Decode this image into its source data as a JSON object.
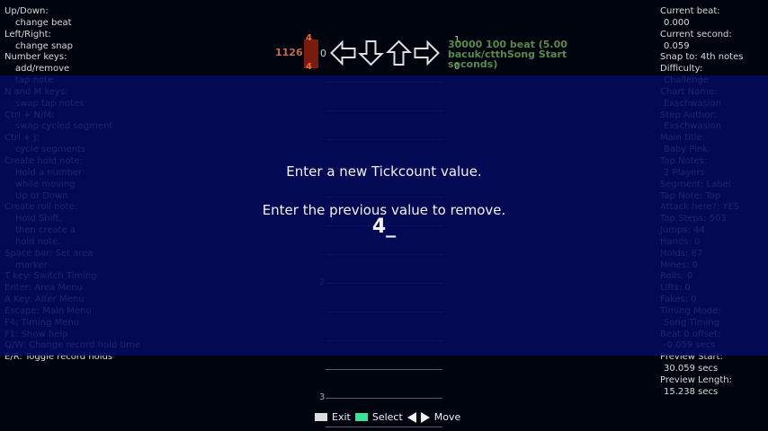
{
  "help": {
    "lines": [
      {
        "text": "Up/Down:",
        "indent": false
      },
      {
        "text": "change beat",
        "indent": true
      },
      {
        "text": "Left/Right:",
        "indent": false
      },
      {
        "text": "change snap",
        "indent": true
      },
      {
        "text": "Number keys:",
        "indent": false
      },
      {
        "text": "add/remove",
        "indent": true
      },
      {
        "text": "tap note",
        "indent": true
      },
      {
        "text": "N and M keys:",
        "indent": false
      },
      {
        "text": "swap tap notes",
        "indent": true
      },
      {
        "text": "Ctrl + N/M:",
        "indent": false
      },
      {
        "text": "swap cycled segment",
        "indent": true
      },
      {
        "text": "Ctrl + J:",
        "indent": false
      },
      {
        "text": "cycle segments",
        "indent": true
      },
      {
        "text": "Create hold note:",
        "indent": false
      },
      {
        "text": "Hold a number",
        "indent": true
      },
      {
        "text": "while moving",
        "indent": true
      },
      {
        "text": "Up or Down",
        "indent": true
      },
      {
        "text": "Create roll note:",
        "indent": false
      },
      {
        "text": "Hold Shift,",
        "indent": true
      },
      {
        "text": "then create a",
        "indent": true
      },
      {
        "text": "hold note.",
        "indent": true
      },
      {
        "text": "Space bar: Set area",
        "indent": false
      },
      {
        "text": "marker",
        "indent": true
      },
      {
        "text": "T key: Switch Timing",
        "indent": false
      },
      {
        "text": "Enter: Area Menu",
        "indent": false
      },
      {
        "text": "A Key: Alter Menu",
        "indent": false
      },
      {
        "text": "Escape: Main Menu",
        "indent": false
      },
      {
        "text": "F4: Timing Menu",
        "indent": false
      },
      {
        "text": "F1: Show help",
        "indent": false
      },
      {
        "text": "Q/W: Change record hold time",
        "indent": false
      },
      {
        "text": "E/R: Toggle record holds",
        "indent": false
      }
    ]
  },
  "info": {
    "lines": [
      {
        "text": "Current beat:",
        "indent": false
      },
      {
        "text": "0.000",
        "indent": true
      },
      {
        "text": "Current second:",
        "indent": false
      },
      {
        "text": "0.059",
        "indent": true
      },
      {
        "text": "Snap to: 4th notes",
        "indent": false
      },
      {
        "text": "Difficulty:",
        "indent": false
      },
      {
        "text": "Challenge",
        "indent": true
      },
      {
        "text": "Chart Name:",
        "indent": false
      },
      {
        "text": "Exschwasion",
        "indent": true
      },
      {
        "text": "Step Author:",
        "indent": false
      },
      {
        "text": "Exschwasion",
        "indent": true
      },
      {
        "text": "Main title:",
        "indent": false
      },
      {
        "text": "Baby Pink",
        "indent": true
      },
      {
        "text": "Tap Notes:",
        "indent": false
      },
      {
        "text": "2 Players",
        "indent": true
      },
      {
        "text": "Segment: Label",
        "indent": false
      },
      {
        "text": "Tap Note: Tap",
        "indent": false
      },
      {
        "text": "Attack here?: YES",
        "indent": false
      },
      {
        "text": "Tap Steps: 503",
        "indent": false
      },
      {
        "text": "Jumps: 44",
        "indent": false
      },
      {
        "text": "Hands: 0",
        "indent": false
      },
      {
        "text": "Holds: 87",
        "indent": false
      },
      {
        "text": "Mines: 0",
        "indent": false
      },
      {
        "text": "Rolls: 0",
        "indent": false
      },
      {
        "text": "Lifts: 0",
        "indent": false
      },
      {
        "text": "Fakes: 0",
        "indent": false
      },
      {
        "text": "Timing Mode:",
        "indent": false
      },
      {
        "text": "Song Timing",
        "indent": true
      },
      {
        "text": "Beat 0 offset:",
        "indent": false
      },
      {
        "text": "-0.059 secs",
        "indent": true
      },
      {
        "text": "Preview Start:",
        "indent": false
      },
      {
        "text": "30.059 secs",
        "indent": true
      },
      {
        "text": "Preview Length:",
        "indent": false
      },
      {
        "text": "15.238 secs",
        "indent": true
      }
    ]
  },
  "editor": {
    "tickcount": "1126",
    "zero_left": "0",
    "snap_top": "4",
    "snap_bottom": "4",
    "right_top": "1",
    "right_bottom": "0",
    "segment_line1": "30000 100 beat (5.00",
    "segment_line2": "bacuk/ctthSong Start",
    "segment_line3": "seconds)",
    "beat_labels": [
      "2",
      "3"
    ],
    "arrows": [
      "left-arrow-icon",
      "down-arrow-icon",
      "up-arrow-icon",
      "right-arrow-icon"
    ]
  },
  "dialog": {
    "title": "Enter a new Tickcount value.",
    "subtitle": "Enter the previous value to remove.",
    "input_value": "4_"
  },
  "footer": {
    "exit_label": "Exit",
    "select_label": "Select",
    "move_label": "Move"
  },
  "colors": {
    "overlay": "#030a5c",
    "select_key": "#3ae29a",
    "snap_marker": "#7a1b10"
  }
}
